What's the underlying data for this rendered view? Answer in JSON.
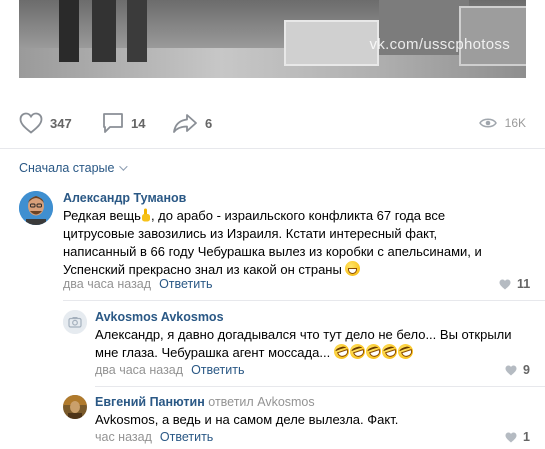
{
  "photo": {
    "watermark": "vk.com/usscphotoss"
  },
  "post_actions": {
    "likes": "347",
    "comments": "14",
    "shares": "6",
    "views": "16K"
  },
  "sort_label": "Сначала старые",
  "comments": [
    {
      "author": "Александр Туманов",
      "text_part1": "Редкая вещь",
      "text_part2": ", до арабо - израильского конфликта 67 года все цитрусовые завозились из Израиля. Кстати интересный факт, написанный в 66 году Чебурашка вылез из коробки с апельсинами, и Успенский прекрасно знал из какой он страны",
      "time": "два часа назад",
      "reply_label": "Ответить",
      "likes": "11",
      "emoji_1": "backhand-index-pointing-up",
      "emoji_2": "grinning-face"
    },
    {
      "author": "Avkosmos Avkosmos",
      "text": "Александр, я давно догадывался что тут дело не бело... Вы открыли мне глаза. Чебурашка агент моссада...",
      "emoji": "rolling-on-the-floor-laughing x5",
      "time": "два часа назад",
      "reply_label": "Ответить",
      "likes": "9"
    },
    {
      "author": "Евгений Панютин",
      "replied_to_prefix": "ответил",
      "replied_to": "Avkosmos",
      "text": "Avkosmos, а ведь и на самом деле вылезла. Факт.",
      "time": "час назад",
      "reply_label": "Ответить",
      "likes": "1"
    }
  ],
  "colors": {
    "link": "#2a5885",
    "meta": "#939393",
    "icon": "#656565",
    "divider": "#e7e8ec"
  }
}
